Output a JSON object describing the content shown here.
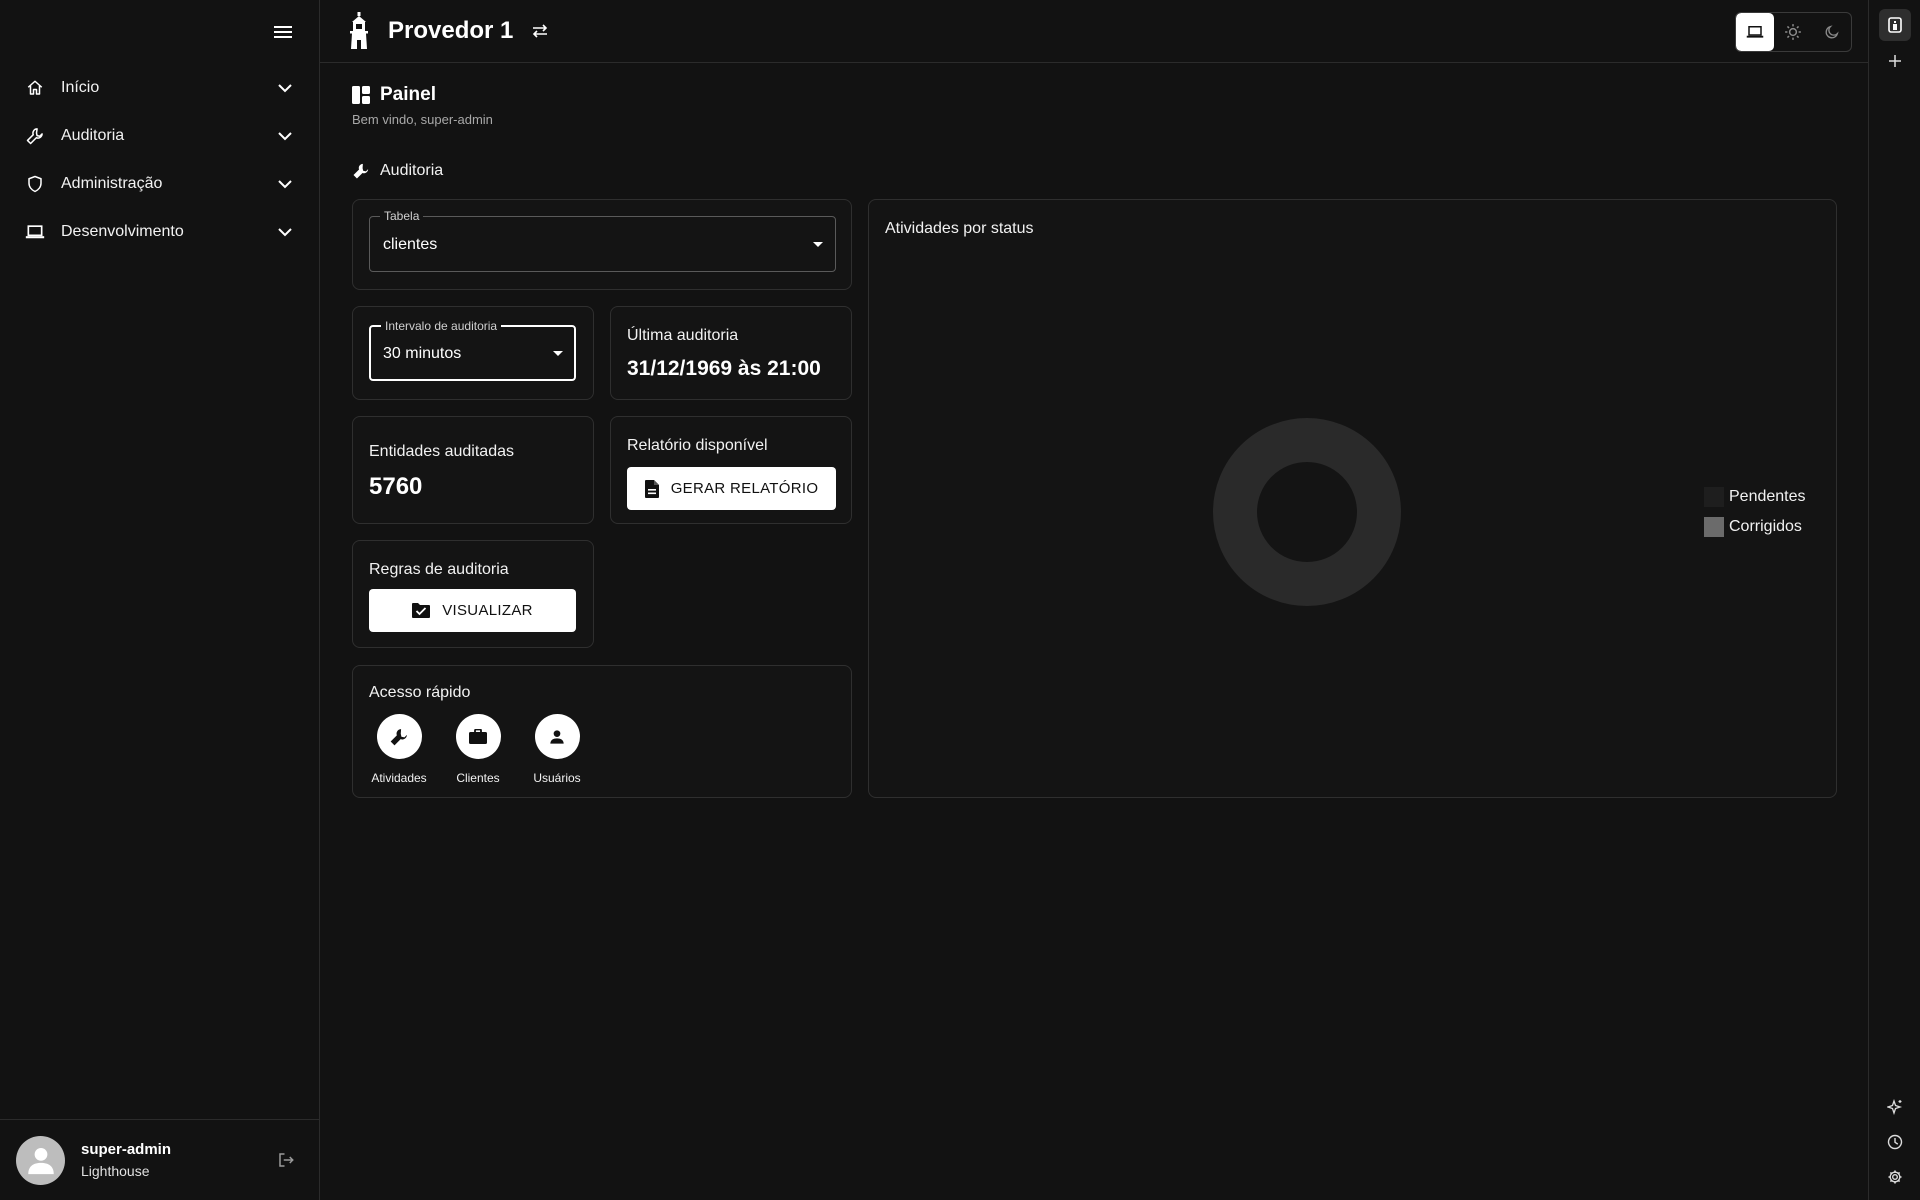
{
  "sidebar": {
    "items": [
      {
        "label": "Início",
        "icon": "home-icon"
      },
      {
        "label": "Auditoria",
        "icon": "wrench-icon"
      },
      {
        "label": "Administração",
        "icon": "shield-icon"
      },
      {
        "label": "Desenvolvimento",
        "icon": "laptop-icon"
      }
    ],
    "user": {
      "name": "super-admin",
      "org": "Lighthouse"
    }
  },
  "topbar": {
    "provider": "Provedor 1",
    "theme_options": [
      "system",
      "light",
      "dark"
    ],
    "theme_selected": "system"
  },
  "page": {
    "title": "Painel",
    "subtitle": "Bem vindo, super-admin",
    "section_title": "Auditoria"
  },
  "audit": {
    "table_label": "Tabela",
    "table_value": "clientes",
    "interval_label": "Intervalo de auditoria",
    "interval_value": "30 minutos",
    "last_audit_title": "Última auditoria",
    "last_audit_value": "31/12/1969 às 21:00",
    "entities_title": "Entidades auditadas",
    "entities_value": "5760",
    "report_title": "Relatório disponível",
    "report_button": "GERAR RELATÓRIO",
    "rules_title": "Regras de auditoria",
    "rules_button": "VISUALIZAR"
  },
  "quick_access": {
    "title": "Acesso rápido",
    "items": [
      {
        "label": "Atividades",
        "icon": "wrench-icon"
      },
      {
        "label": "Clientes",
        "icon": "briefcase-icon"
      },
      {
        "label": "Usuários",
        "icon": "person-icon"
      }
    ]
  },
  "colors": {
    "background": "#121212",
    "pendentes": "#1e1e1e",
    "corrigidos": "#6b6b6b",
    "donut": "#2a2a2a"
  },
  "chart_data": {
    "type": "pie",
    "title": "Atividades por status",
    "categories": [
      "Pendentes",
      "Corrigidos"
    ],
    "values": [
      0,
      0
    ],
    "legend_position": "right"
  }
}
